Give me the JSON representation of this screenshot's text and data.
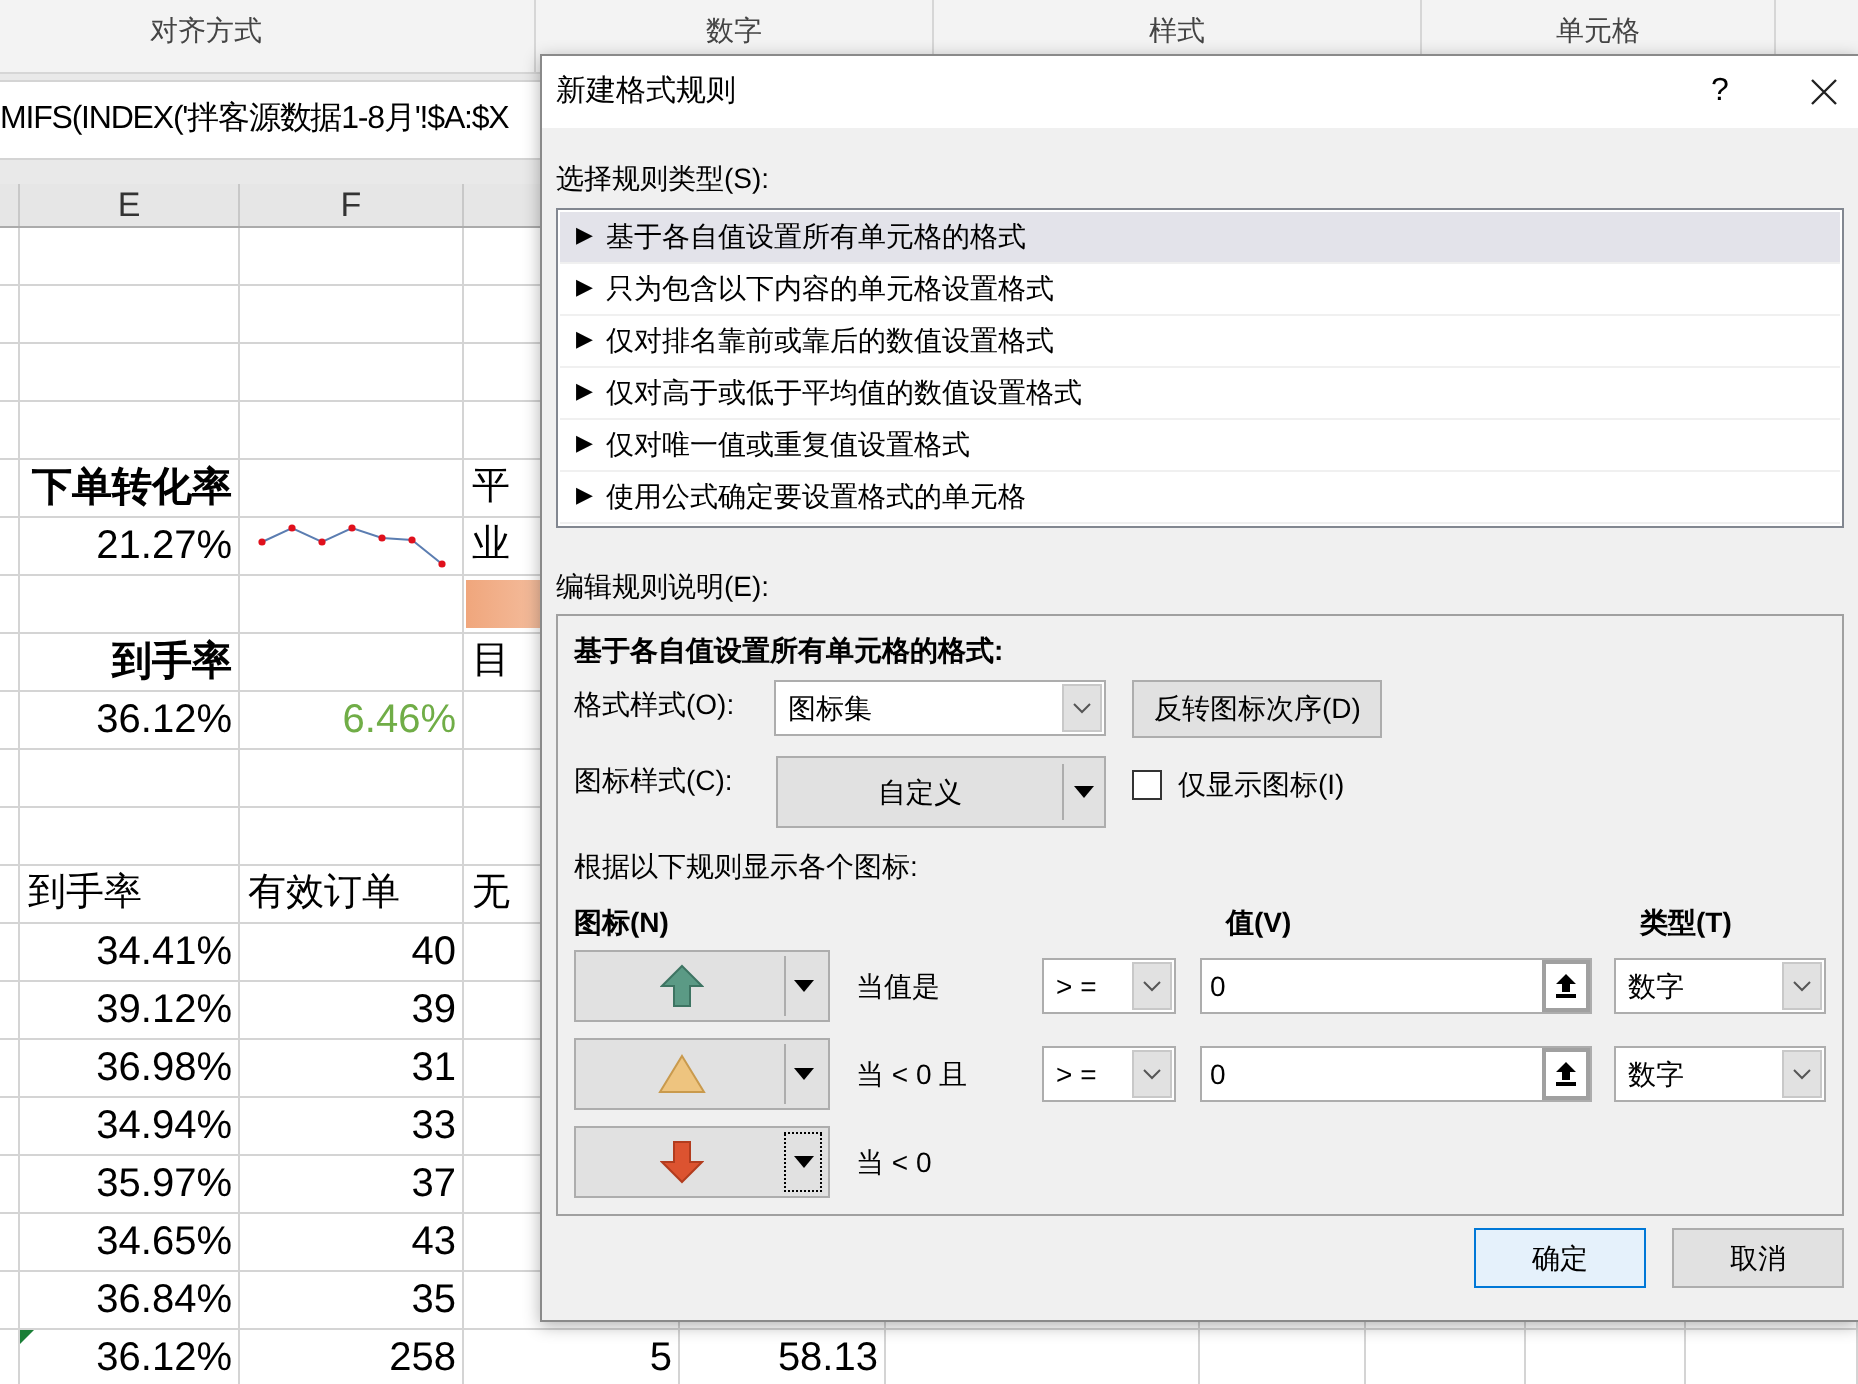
{
  "ribbon": {
    "groups": [
      {
        "label": "对齐方式"
      },
      {
        "label": "数字"
      },
      {
        "label": "样式"
      },
      {
        "label": "单元格"
      }
    ]
  },
  "formula_bar": {
    "value": "MIFS(INDEX('拌客源数据1-8月'!$A:$X"
  },
  "sheet": {
    "column_headers": [
      "E",
      "F"
    ],
    "rows": [
      [
        null,
        null,
        null,
        null,
        null
      ],
      [
        null,
        null,
        null,
        null,
        null
      ],
      [
        null,
        null,
        null,
        null,
        null
      ],
      [
        null,
        null,
        null,
        null,
        null
      ],
      [
        null,
        {
          "kind": "heading",
          "text": "下单转化率"
        },
        null,
        {
          "kind": "text",
          "text": "平"
        },
        null
      ],
      [
        null,
        {
          "kind": "number",
          "text": "21.27%"
        },
        {
          "kind": "sparkline"
        },
        {
          "kind": "text",
          "text": "业"
        },
        null
      ],
      [
        null,
        null,
        null,
        {
          "kind": "data-bar"
        },
        null
      ],
      [
        null,
        {
          "kind": "heading",
          "text": "到手率"
        },
        null,
        {
          "kind": "text",
          "text": "目"
        },
        null
      ],
      [
        null,
        {
          "kind": "number",
          "text": "36.12%"
        },
        {
          "kind": "number",
          "text": "6.46%",
          "color": "#70ad47"
        },
        null,
        null
      ],
      [
        null,
        null,
        null,
        null,
        null
      ],
      [
        null,
        null,
        null,
        null,
        null
      ],
      [
        null,
        {
          "kind": "text",
          "text": "到手率"
        },
        {
          "kind": "text",
          "text": "有效订单"
        },
        {
          "kind": "text",
          "text": "无"
        },
        null
      ],
      [
        null,
        {
          "kind": "number",
          "text": "34.41%"
        },
        {
          "kind": "number",
          "text": "40"
        },
        null,
        null
      ],
      [
        null,
        {
          "kind": "number",
          "text": "39.12%"
        },
        {
          "kind": "number",
          "text": "39"
        },
        null,
        null
      ],
      [
        null,
        {
          "kind": "number",
          "text": "36.98%"
        },
        {
          "kind": "number",
          "text": "31"
        },
        null,
        null
      ],
      [
        null,
        {
          "kind": "number",
          "text": "34.94%"
        },
        {
          "kind": "number",
          "text": "33"
        },
        null,
        null
      ],
      [
        null,
        {
          "kind": "number",
          "text": "35.97%"
        },
        {
          "kind": "number",
          "text": "37"
        },
        null,
        null
      ],
      [
        null,
        {
          "kind": "number",
          "text": "34.65%"
        },
        {
          "kind": "number",
          "text": "43"
        },
        null,
        null
      ],
      [
        null,
        {
          "kind": "number",
          "text": "36.84%"
        },
        {
          "kind": "number",
          "text": "35"
        },
        null,
        null
      ],
      [
        null,
        {
          "kind": "number",
          "text": "36.12%"
        },
        {
          "kind": "number",
          "text": "258"
        },
        {
          "kind": "number",
          "text": "5"
        },
        {
          "kind": "number",
          "text": "58.13"
        }
      ]
    ]
  },
  "dialog": {
    "title": "新建格式规则",
    "help": "?",
    "rule_type_label": "选择规则类型(S):",
    "rule_types": [
      {
        "marker": "▶",
        "label": "基于各自值设置所有单元格的格式",
        "selected": true
      },
      {
        "marker": "▶",
        "label": "只为包含以下内容的单元格设置格式",
        "selected": false
      },
      {
        "marker": "▶",
        "label": "仅对排名靠前或靠后的数值设置格式",
        "selected": false
      },
      {
        "marker": "▶",
        "label": "仅对高于或低于平均值的数值设置格式",
        "selected": false
      },
      {
        "marker": "▶",
        "label": "仅对唯一值或重复值设置格式",
        "selected": false
      },
      {
        "marker": "▶",
        "label": "使用公式确定要设置格式的单元格",
        "selected": false
      }
    ],
    "description_label": "编辑规则说明(E):",
    "description": {
      "title": "基于各自值设置所有单元格的格式:",
      "format_style_label": "格式样式(O):",
      "format_style": "图标集",
      "reverse_button": "反转图标次序(D)",
      "icon_style_label": "图标样式(C):",
      "icon_style": "自定义",
      "show_icon_only": {
        "label": "仅显示图标(I)",
        "checked": false
      },
      "rules_label": "根据以下规则显示各个图标:",
      "headers": {
        "icon": "图标(N)",
        "value": "值(V)",
        "type": "类型(T)"
      },
      "icon_rules": [
        {
          "kind": "arrow-up",
          "focused": false,
          "condition": "当值是",
          "operator": "> =",
          "value": "0",
          "type": "数字"
        },
        {
          "kind": "triangle",
          "focused": false,
          "condition": "当 < 0 且",
          "operator": "> =",
          "value": "0",
          "type": "数字"
        },
        {
          "kind": "arrow-down",
          "focused": true,
          "condition": "当 < 0"
        }
      ]
    },
    "buttons": [
      {
        "label": "确定",
        "default": true
      },
      {
        "label": "取消",
        "default": false
      }
    ]
  }
}
